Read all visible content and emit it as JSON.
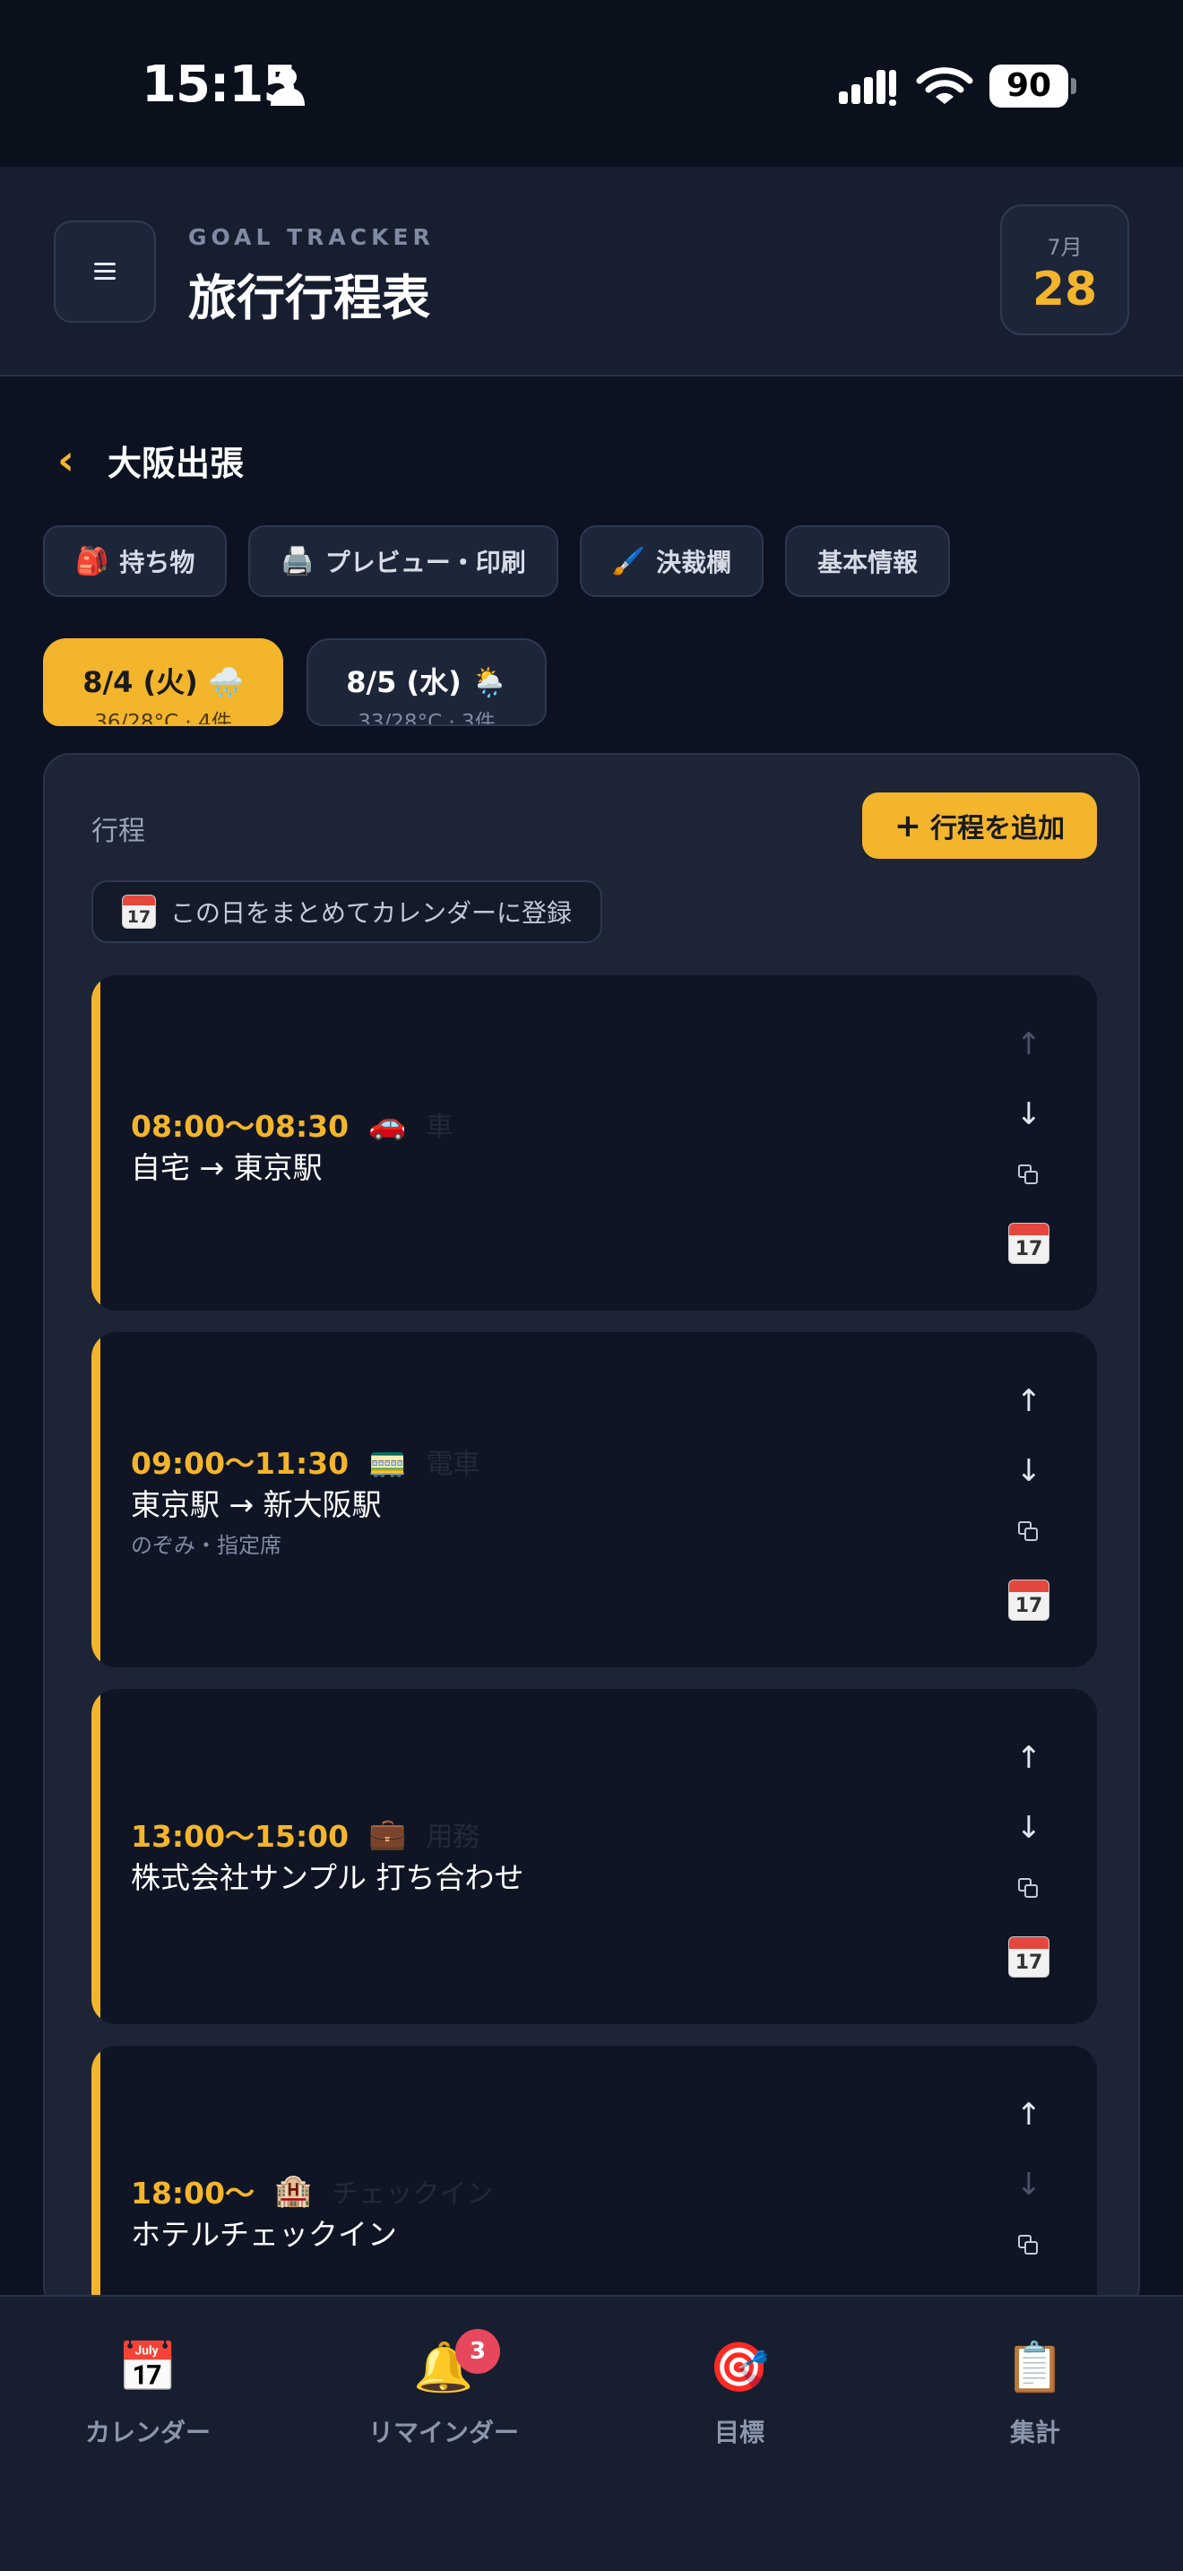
{
  "status_bar": {
    "time": "15:15",
    "battery": "90",
    "icons": [
      "person-icon",
      "signal-icon",
      "wifi-icon",
      "battery-icon"
    ]
  },
  "header": {
    "eyebrow": "GOAL TRACKER",
    "title": "旅行行程表",
    "date_month": "7月",
    "date_day": "28",
    "menu_icon": "≡"
  },
  "trip": {
    "back_icon": "‹",
    "title": "大阪出張"
  },
  "chips": [
    {
      "emoji": "🎒",
      "label": "持ち物"
    },
    {
      "emoji": "🖨️",
      "label": "プレビュー・印刷"
    },
    {
      "emoji": "🖌️",
      "label": "決裁欄"
    },
    {
      "emoji": "",
      "label": "基本情報"
    }
  ],
  "day_tabs": [
    {
      "label": "8/4 (火)",
      "emoji": "🌧️",
      "sub": "36/28°C · 4件",
      "active": true
    },
    {
      "label": "8/5 (水)",
      "emoji": "🌦️",
      "sub": "33/28°C · 3件",
      "active": false
    }
  ],
  "panel": {
    "title": "行程",
    "add_button_plus": "+",
    "add_button": "行程を追加",
    "calendar_all_label": "この日をまとめてカレンダーに登録",
    "calendar_day": "17"
  },
  "items": [
    {
      "time": "08:00〜08:30",
      "emoji": "🚗",
      "category": "車",
      "route": "自宅 → 東京駅",
      "note": ""
    },
    {
      "time": "09:00〜11:30",
      "emoji": "🚃",
      "category": "電車",
      "route": "東京駅 → 新大阪駅",
      "note": "のぞみ・指定席"
    },
    {
      "time": "13:00〜15:00",
      "emoji": "💼",
      "category": "用務",
      "route": "株式会社サンプル 打ち合わせ",
      "note": ""
    },
    {
      "time": "18:00〜",
      "emoji": "🏨",
      "category": "チェックイン",
      "route": "ホテルチェックイン",
      "note": ""
    }
  ],
  "item_actions": {
    "up": "↑",
    "down": "↓"
  },
  "bottom_nav": [
    {
      "icon": "📅",
      "icon_name": "calendar-icon",
      "label": "カレンダー"
    },
    {
      "icon": "🔔",
      "icon_name": "bell-icon",
      "label": "リマインダー",
      "badge": "3"
    },
    {
      "icon": "🎯",
      "icon_name": "target-icon",
      "label": "目標"
    },
    {
      "icon": "📋",
      "icon_name": "clipboard-chart-icon",
      "label": "集計"
    }
  ],
  "colors": {
    "accent": "#f3b52c",
    "background": "#0c1222",
    "card": "#0f1524",
    "badge": "#e7475c"
  }
}
